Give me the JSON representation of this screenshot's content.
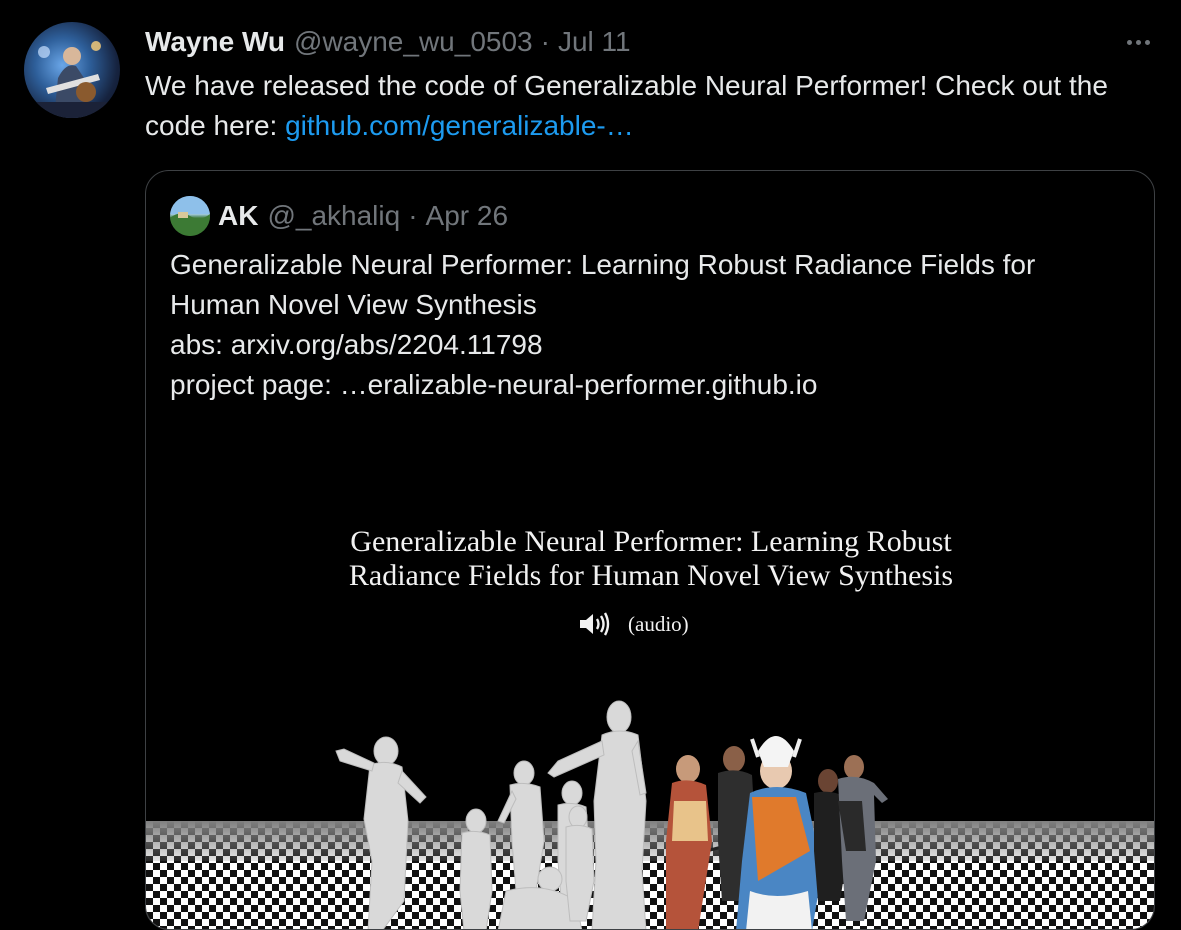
{
  "tweet": {
    "author_name": "Wayne Wu",
    "handle": "@wayne_wu_0503",
    "separator": "·",
    "date": "Jul 11",
    "text_prefix": "We have released the code of Generalizable Neural Performer! Check out the code here: ",
    "link": "github.com/generalizable-…",
    "more_icon": "more-horizontal-icon"
  },
  "quote": {
    "author_name": "AK",
    "handle": "@_akhaliq",
    "separator": "·",
    "date": "Apr 26",
    "lines": [
      "Generalizable Neural Performer: Learning Robust Radiance Fields for",
      "Human Novel View Synthesis",
      "abs: arxiv.org/abs/2204.11798",
      "project page: …eralizable-neural-performer.github.io"
    ],
    "media": {
      "title_line1": "Generalizable Neural Performer: Learning Robust",
      "title_line2": "Radiance Fields for Human Novel View Synthesis",
      "audio_label": "(audio)",
      "audio_icon": "speaker-icon"
    }
  },
  "colors": {
    "background": "#000000",
    "text": "#e7e9ea",
    "muted": "#71767b",
    "link": "#1d9bf0",
    "border": "#3e4144"
  }
}
